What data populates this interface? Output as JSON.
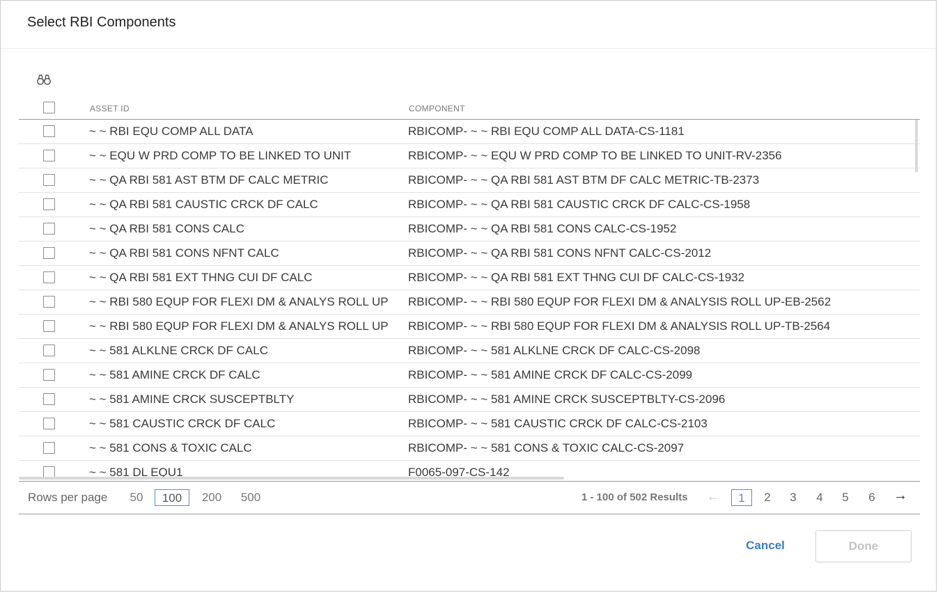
{
  "dialog": {
    "title": "Select RBI Components"
  },
  "toolbar": {
    "search_icon": "binoculars-icon"
  },
  "table": {
    "columns": [
      "ASSET ID",
      "COMPONENT"
    ],
    "rows": [
      {
        "asset_id": "~ ~ RBI EQU COMP ALL DATA",
        "component": "RBICOMP- ~ ~ RBI EQU COMP ALL DATA-CS-1181"
      },
      {
        "asset_id": "~ ~ EQU W PRD COMP TO BE LINKED TO UNIT",
        "component": "RBICOMP- ~ ~ EQU W PRD COMP TO BE LINKED TO UNIT-RV-2356"
      },
      {
        "asset_id": "~ ~ QA RBI 581 AST BTM DF CALC METRIC",
        "component": "RBICOMP- ~ ~ QA RBI 581 AST BTM DF CALC METRIC-TB-2373"
      },
      {
        "asset_id": "~ ~ QA RBI 581 CAUSTIC CRCK DF CALC",
        "component": "RBICOMP- ~ ~ QA RBI 581 CAUSTIC CRCK DF CALC-CS-1958"
      },
      {
        "asset_id": "~ ~ QA RBI 581 CONS CALC",
        "component": "RBICOMP- ~ ~ QA RBI 581 CONS CALC-CS-1952"
      },
      {
        "asset_id": "~ ~ QA RBI 581 CONS NFNT CALC",
        "component": "RBICOMP- ~ ~ QA RBI 581 CONS NFNT CALC-CS-2012"
      },
      {
        "asset_id": "~ ~ QA RBI 581 EXT THNG CUI DF CALC",
        "component": "RBICOMP- ~ ~ QA RBI 581 EXT THNG CUI DF CALC-CS-1932"
      },
      {
        "asset_id": "~ ~ RBI 580 EQUP FOR FLEXI DM & ANALYS ROLL UP",
        "component": "RBICOMP- ~ ~ RBI 580 EQUP FOR FLEXI DM & ANALYSIS ROLL UP-EB-2562"
      },
      {
        "asset_id": "~ ~ RBI 580 EQUP FOR FLEXI DM & ANALYS ROLL UP",
        "component": "RBICOMP- ~ ~ RBI 580 EQUP FOR FLEXI DM & ANALYSIS ROLL UP-TB-2564"
      },
      {
        "asset_id": "~ ~ 581 ALKLNE CRCK DF CALC",
        "component": "RBICOMP- ~ ~ 581 ALKLNE CRCK DF CALC-CS-2098"
      },
      {
        "asset_id": "~ ~ 581 AMINE CRCK DF CALC",
        "component": "RBICOMP- ~ ~ 581 AMINE CRCK DF CALC-CS-2099"
      },
      {
        "asset_id": "~ ~ 581 AMINE CRCK SUSCEPTBLTY",
        "component": "RBICOMP- ~ ~ 581 AMINE CRCK SUSCEPTBLTY-CS-2096"
      },
      {
        "asset_id": "~ ~ 581 CAUSTIC CRCK DF CALC",
        "component": "RBICOMP- ~ ~ 581 CAUSTIC CRCK DF CALC-CS-2103"
      },
      {
        "asset_id": "~ ~ 581 CONS & TOXIC CALC",
        "component": "RBICOMP- ~ ~ 581 CONS & TOXIC CALC-CS-2097"
      },
      {
        "asset_id": "~ ~ 581 DL EQU1",
        "component": "F0065-097-CS-142"
      }
    ]
  },
  "pagination": {
    "rows_per_page_label": "Rows per page",
    "rows_per_page_options": [
      "50",
      "100",
      "200",
      "500"
    ],
    "rows_per_page_selected": "100",
    "results_text": "1 - 100 of 502 Results",
    "prev_arrow": "←",
    "next_arrow": "→",
    "pages": [
      "1",
      "2",
      "3",
      "4",
      "5",
      "6"
    ],
    "current_page": "1"
  },
  "actions": {
    "cancel_label": "Cancel",
    "done_label": "Done"
  },
  "colors": {
    "accent": "#4a90d9",
    "link": "#3b7bc8",
    "disabled": "#c2c2c2"
  }
}
